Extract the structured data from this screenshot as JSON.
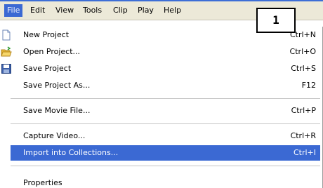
{
  "menubar": {
    "items": [
      "File",
      "Edit",
      "View",
      "Tools",
      "Clip",
      "Play",
      "Help"
    ]
  },
  "callout": {
    "number": "1"
  },
  "file_menu": {
    "items": [
      {
        "label": "New Project",
        "shortcut": "Ctrl+N",
        "icon": "new-document-icon"
      },
      {
        "label": "Open Project...",
        "shortcut": "Ctrl+O",
        "icon": "open-folder-icon"
      },
      {
        "label": "Save Project",
        "shortcut": "Ctrl+S",
        "icon": "save-floppy-icon"
      },
      {
        "label": "Save Project As...",
        "shortcut": "F12"
      },
      {
        "label": "Save Movie File...",
        "shortcut": "Ctrl+P"
      },
      {
        "label": "Capture Video...",
        "shortcut": "Ctrl+R"
      },
      {
        "label": "Import into Collections...",
        "shortcut": "Ctrl+I",
        "highlighted": true
      },
      {
        "label": "Properties"
      }
    ]
  },
  "colors": {
    "highlight": "#3b69d3",
    "menubar_bg": "#ece9d8"
  }
}
